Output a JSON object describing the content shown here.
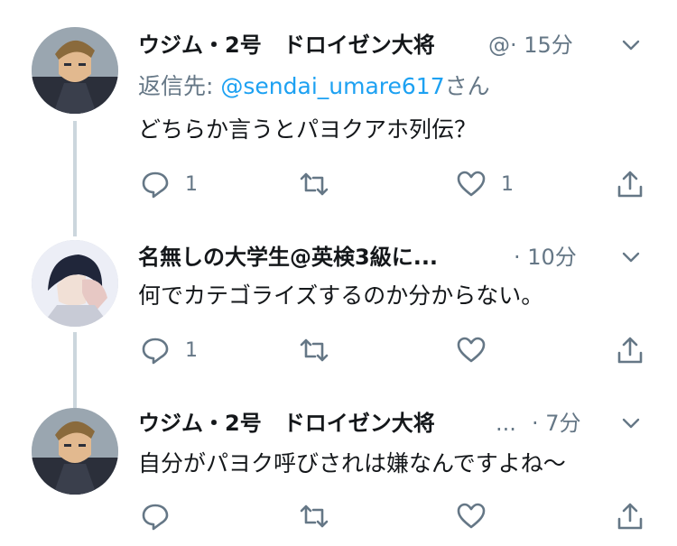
{
  "tweets": [
    {
      "name": "ウジム・2号　ドロイゼン大将",
      "handle": "@",
      "time": "· 15分",
      "reply_label": "返信先: ",
      "reply_mention": "@sendai_umare617",
      "reply_suffix": "さん",
      "text": "どちらか言うとパヨクアホ列伝？",
      "reply_count": "1",
      "retweet_count": "",
      "like_count": "1"
    },
    {
      "name": "名無しの大学生@英検3級に...",
      "time": "· 10分",
      "text": "何でカテゴライズするのか分からない。",
      "reply_count": "1",
      "retweet_count": "",
      "like_count": ""
    },
    {
      "name": "ウジム・2号　ドロイゼン大将",
      "handle": "...",
      "time": "· 7分",
      "text": "自分がパヨク呼びされは嫌なんですよね～",
      "reply_count": "",
      "retweet_count": "",
      "like_count": ""
    }
  ],
  "colors": {
    "text": "#14171a",
    "secondary": "#657786",
    "link": "#1da1f2",
    "thread_line": "#ccd6dd"
  },
  "icons": [
    "reply-icon",
    "retweet-icon",
    "like-icon",
    "share-icon",
    "chevron-down-icon"
  ]
}
